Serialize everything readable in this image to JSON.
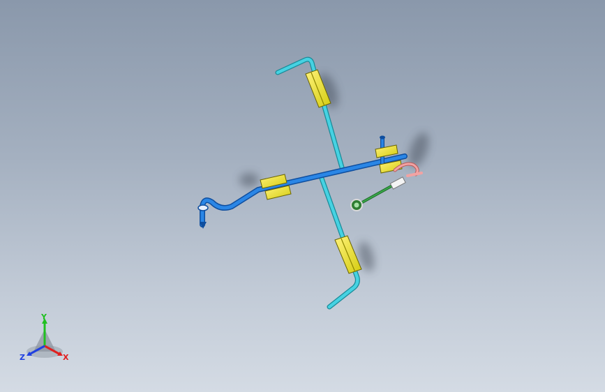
{
  "viewport": {
    "background_top": "#8a98ab",
    "background_bottom": "#d4dbe4"
  },
  "model": {
    "pipe_main_color": "#1f6fd1",
    "pipe_branch_color": "#3fc8d8",
    "support_color": "#e8e21a",
    "accent_red": "#e88a8a",
    "accent_green": "#2e8b3a"
  },
  "triad": {
    "x_label": "X",
    "y_label": "Y",
    "z_label": "Z",
    "x_color": "#e02020",
    "y_color": "#20c020",
    "z_color": "#2040e0"
  }
}
